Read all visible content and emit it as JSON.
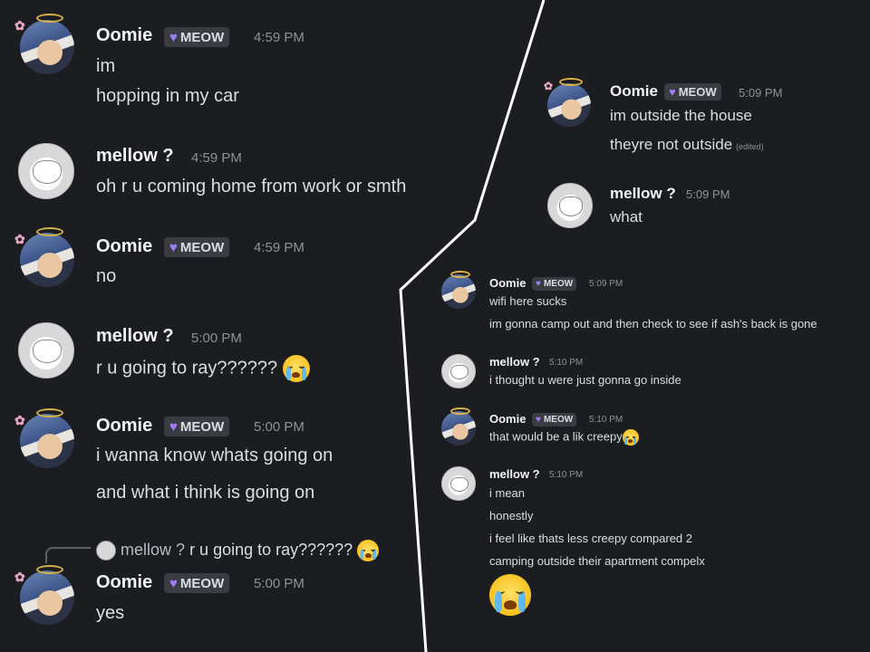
{
  "role_tag": {
    "label": "MEOW",
    "heart_color": "#a27df5"
  },
  "left": {
    "messages": [
      {
        "author": "Oomie",
        "time": "4:59 PM",
        "lines": [
          "im",
          "hopping in my car"
        ]
      },
      {
        "author": "mellow ?",
        "time": "4:59 PM",
        "lines": [
          "oh r u coming home from work or smth"
        ]
      },
      {
        "author": "Oomie",
        "time": "4:59 PM",
        "lines": [
          "no"
        ]
      },
      {
        "author": "mellow ?",
        "time": "5:00 PM",
        "lines": [
          "r u going to ray??????"
        ]
      },
      {
        "author": "Oomie",
        "time": "5:00 PM",
        "lines": [
          "i wanna know whats going on",
          "and what i think is going on"
        ]
      },
      {
        "author": "Oomie",
        "time": "5:00 PM",
        "lines": [
          "yes"
        ],
        "reply": {
          "author": "mellow ?",
          "text": "r u going to ray??????"
        }
      }
    ]
  },
  "right_top": {
    "messages": [
      {
        "author": "Oomie",
        "time": "5:09 PM",
        "lines": [
          "im outside the house",
          "theyre not outside"
        ],
        "edited": "(edited)"
      },
      {
        "author": "mellow ?",
        "time": "5:09 PM",
        "lines": [
          "what"
        ]
      }
    ]
  },
  "right_bottom": {
    "messages": [
      {
        "author": "Oomie",
        "time": "5:09 PM",
        "lines": [
          "wifi here sucks",
          "im gonna camp out and then check to see if ash's back is gone"
        ]
      },
      {
        "author": "mellow ?",
        "time": "5:10 PM",
        "lines": [
          "i thought u were just gonna go inside"
        ]
      },
      {
        "author": "Oomie",
        "time": "5:10 PM",
        "lines": [
          "that would be a lik creepy"
        ]
      },
      {
        "author": "mellow ?",
        "time": "5:10 PM",
        "lines": [
          "i mean",
          "honestly",
          "i feel like thats less creepy compared 2",
          "camping outside their apartment compelx"
        ]
      }
    ]
  },
  "icons": {
    "crying": "loudly-crying-face-icon",
    "heart": "purple-heart-icon"
  }
}
